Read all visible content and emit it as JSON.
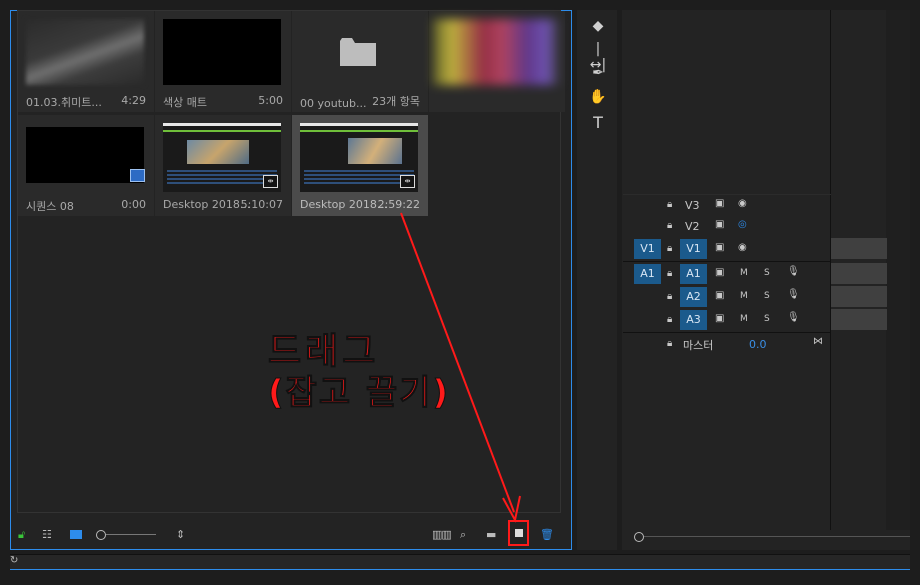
{
  "project": {
    "items": [
      {
        "name": "01.03.취미트...",
        "duration": "4:29"
      },
      {
        "name": "색상 매트",
        "duration": "5:00"
      },
      {
        "name": "00 youtub...",
        "duration": "23개 항목"
      },
      {
        "name": "",
        "duration": ""
      },
      {
        "name": "시퀀스 08",
        "duration": "0:00"
      },
      {
        "name": "Desktop 2018...",
        "duration": "5:10:07"
      },
      {
        "name": "Desktop 2018...",
        "duration": "2:59:22"
      }
    ]
  },
  "timeline": {
    "tracks": [
      {
        "label": "V3"
      },
      {
        "label": "V2"
      },
      {
        "label": "V1",
        "source": "V1"
      },
      {
        "label": "A1",
        "source": "A1"
      },
      {
        "label": "A2"
      },
      {
        "label": "A3"
      }
    ],
    "master_label": "마스터",
    "master_value": "0.0",
    "mute_label": "M",
    "solo_label": "S"
  },
  "annotation": {
    "line1": "드래그",
    "line2": "(잡고 끌기)"
  },
  "colors": {
    "accent": "#2d8ceb",
    "annotation": "#ff1a1a",
    "track_target": "#1b5a8c"
  }
}
